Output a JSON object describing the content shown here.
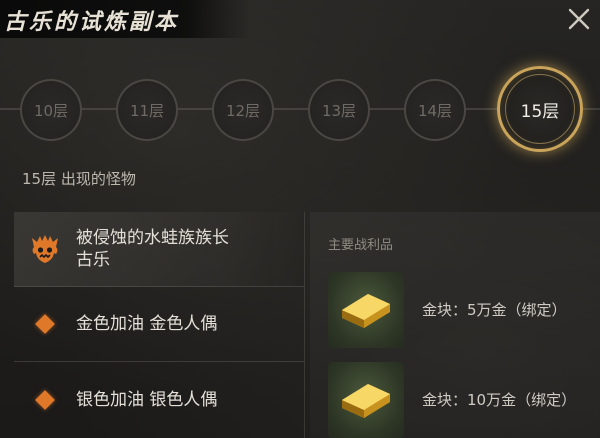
{
  "header": {
    "title": "古乐的试炼副本"
  },
  "floors": [
    {
      "label": "10层",
      "active": false
    },
    {
      "label": "11层",
      "active": false
    },
    {
      "label": "12层",
      "active": false
    },
    {
      "label": "13层",
      "active": false
    },
    {
      "label": "14层",
      "active": false
    },
    {
      "label": "15层",
      "active": true
    }
  ],
  "monsters_section": {
    "title": "15层 出现的怪物"
  },
  "monsters": [
    {
      "name": "被侵蚀的水蛙族族长 古乐",
      "type": "boss",
      "icon": "boss-skull-icon"
    },
    {
      "name": "金色加油 金色人偶",
      "type": "normal",
      "icon": "diamond-icon"
    },
    {
      "name": "银色加油 银色人偶",
      "type": "normal",
      "icon": "diamond-icon"
    }
  ],
  "loot": {
    "header": "主要战利品",
    "items": [
      {
        "label": "金块：5万金（绑定）",
        "icon": "gold-bar-icon"
      },
      {
        "label": "金块：10万金（绑定）",
        "icon": "gold-bar-icon"
      }
    ]
  },
  "colors": {
    "accent_gold": "#c9a45a",
    "boss_orange": "#e0782a"
  }
}
